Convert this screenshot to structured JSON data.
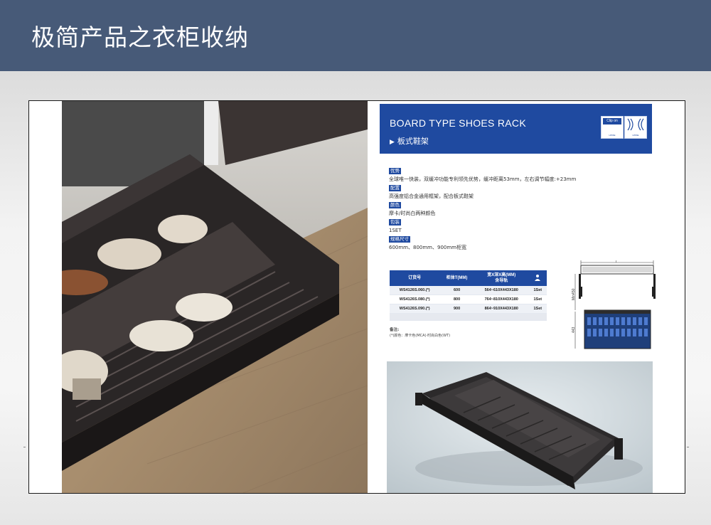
{
  "header": {
    "title": "极简产品之衣柜收纳",
    "bg_color": "#475a78"
  },
  "catalog": {
    "banner": {
      "title": "BOARD TYPE SHOES RACK",
      "subtitle": "板式鞋架",
      "color": "#1f4aa0",
      "badge_clip": {
        "label": "Clip on",
        "caption": "HISSE"
      },
      "badge_damping": {
        "caption": "HISSE",
        "icon": "soft-close-icon"
      }
    },
    "specs": [
      {
        "label": "优势",
        "text": "全球唯一快装，双缓冲功能专利领先优势，缓冲距离53mm，左右调节幅度:+23mm"
      },
      {
        "label": "配置",
        "text": "高强度铝合金通用框架，配合板式鞋架"
      },
      {
        "label": "颜色",
        "text": "摩卡/时尚白两种颜色"
      },
      {
        "label": "包装",
        "text": "1SET"
      },
      {
        "label": "规格尺寸",
        "text": "600mm、800mm、900mm柜宽"
      }
    ],
    "table": {
      "headers": [
        "订货号",
        "柜体T(MM)",
        "宽X深X高(MM)\n含导轨",
        ""
      ],
      "header_icon": "person-icon",
      "rows": [
        [
          "WS4126S.060.(*)",
          "600",
          "564~610X443X180",
          "1Set"
        ],
        [
          "WS4126S.080.(*)",
          "800",
          "764~810X443X180",
          "1Set"
        ],
        [
          "WS4126S.090.(*)",
          "900",
          "864~910X443X180",
          "1Set"
        ]
      ]
    },
    "notes": {
      "title": "备注:",
      "text": "(*)颜色：摩卡色(MCA)·时尚白色(WT)"
    },
    "drawing": {
      "width_label": "T",
      "height_label": "Min450",
      "depth_label": "443"
    }
  }
}
